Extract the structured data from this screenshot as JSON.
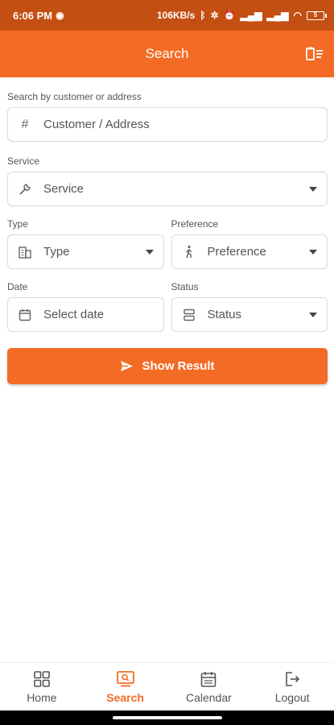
{
  "status_bar": {
    "time": "6:06 PM",
    "network_speed": "106KB/s",
    "battery": "5"
  },
  "app_bar": {
    "title": "Search"
  },
  "form": {
    "search": {
      "label": "Search by customer or address",
      "placeholder": "Customer / Address"
    },
    "service": {
      "label": "Service",
      "placeholder": "Service"
    },
    "type": {
      "label": "Type",
      "placeholder": "Type"
    },
    "preference": {
      "label": "Preference",
      "placeholder": "Preference"
    },
    "date": {
      "label": "Date",
      "placeholder": "Select date"
    },
    "status": {
      "label": "Status",
      "placeholder": "Status"
    }
  },
  "show_result_label": "Show Result",
  "nav": {
    "home": "Home",
    "search": "Search",
    "calendar": "Calendar",
    "logout": "Logout"
  },
  "colors": {
    "accent": "#f36b25",
    "status_bar": "#c44f12"
  }
}
